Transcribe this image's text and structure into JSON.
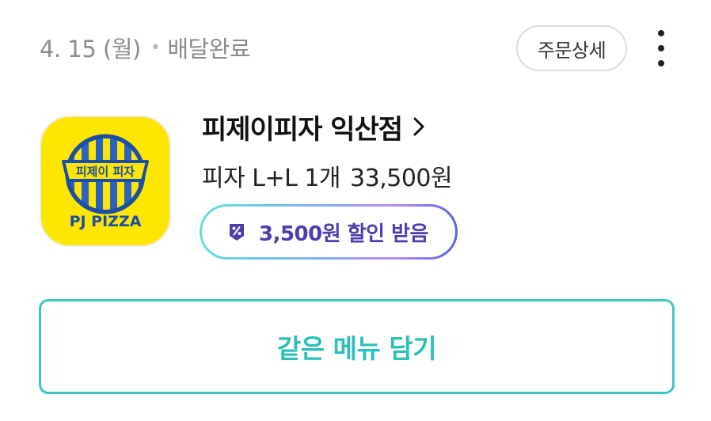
{
  "order": {
    "date": "4. 15 (월)",
    "separator": "•",
    "status": "배달완료",
    "detail_button_label": "주문상세",
    "more_icon": "more-vertical-icon"
  },
  "store": {
    "logo_text_ko": "피제이 피자",
    "logo_text_en": "PJ PIZZA",
    "logo_colors": {
      "background": "#ffe600",
      "primary": "#1b4fa6"
    },
    "name": "피제이피자 익산점",
    "name_icon": "chevron-right-icon"
  },
  "summary": {
    "item": "피자 L+L 1개",
    "price": "33,500원"
  },
  "discount": {
    "icon": "coupon-percent-icon",
    "text": "3,500원 할인 받음",
    "text_color": "#4b3fae"
  },
  "actions": {
    "reorder_label": "같은 메뉴 담기",
    "accent_color": "#2cc0bb"
  }
}
